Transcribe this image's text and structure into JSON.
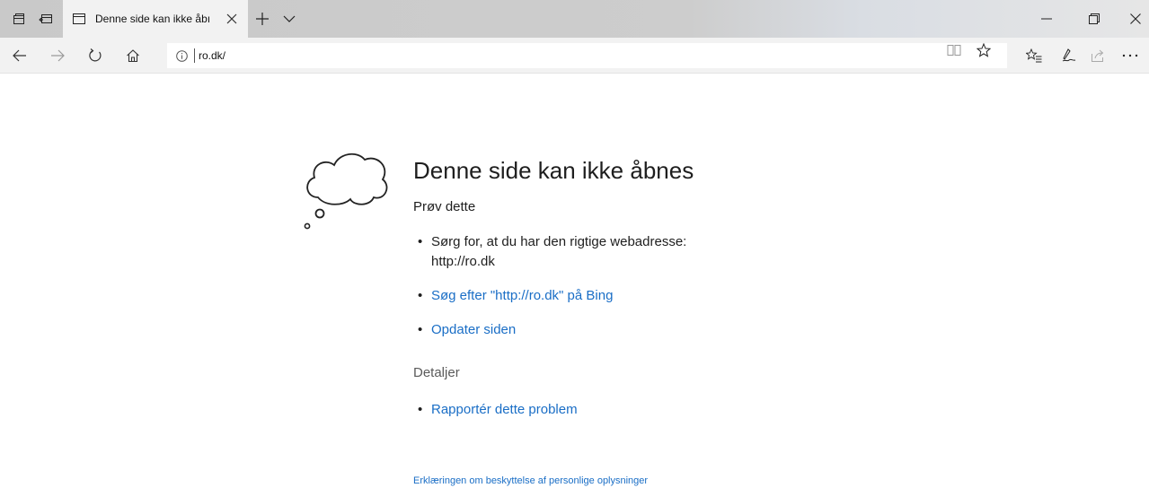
{
  "browser": {
    "tab_title": "Denne side kan ikke åbı",
    "address_url": "ro.dk/",
    "icons": {
      "set_aside": "set-aside-tabs-icon",
      "tabs_preview": "show-tabs-icon",
      "page": "page-icon",
      "close_tab": "close-icon",
      "new_tab": "plus-icon",
      "tab_menu": "chevron-down-icon",
      "minimize": "minimize-icon",
      "maximize": "restore-icon",
      "close_window": "close-icon",
      "back": "back-arrow-icon",
      "forward": "forward-arrow-icon",
      "refresh": "refresh-icon",
      "home": "home-icon",
      "info": "info-icon",
      "reading_view": "book-icon",
      "favorite": "star-icon",
      "favorites_hub": "favorites-list-icon",
      "notes": "pen-icon",
      "share": "share-icon",
      "more": "more-icon"
    }
  },
  "error_page": {
    "heading": "Denne side kan ikke åbnes",
    "try_label": "Prøv dette",
    "suggestion_check_url_line1": "Sørg for, at du har den rigtige webadresse:",
    "suggestion_check_url_line2": "http://ro.dk",
    "suggestion_search": "Søg efter \"http://ro.dk\" på Bing",
    "suggestion_refresh": "Opdater siden",
    "details_label": "Detaljer",
    "report_link": "Rapportér dette problem",
    "privacy_link": "Erklæringen om beskyttelse af personlige oplysninger"
  },
  "colors": {
    "link": "#1a6ec6",
    "tab_bar": "#cdcdcd",
    "toolbar": "#f2f2f2"
  }
}
